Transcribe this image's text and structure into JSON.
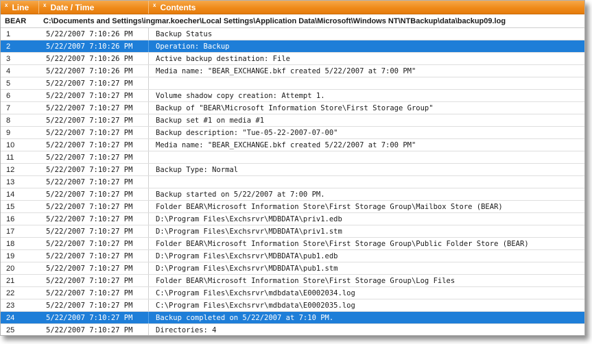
{
  "columns": {
    "line": "Line",
    "date": "Date / Time",
    "contents": "Contents",
    "close_glyph": "x"
  },
  "group": {
    "name": "BEAR",
    "path": "C:\\Documents and Settings\\ingmar.koecher\\Local Settings\\Application Data\\Microsoft\\Windows NT\\NTBackup\\data\\backup09.log"
  },
  "colors": {
    "header_orange": "#ef8a1a",
    "selection_blue": "#1e7ed8"
  },
  "rows": [
    {
      "line": "1",
      "date": "5/22/2007 7:10:26 PM",
      "contents": "Backup Status",
      "selected": false
    },
    {
      "line": "2",
      "date": "5/22/2007 7:10:26 PM",
      "contents": "Operation: Backup",
      "selected": true
    },
    {
      "line": "3",
      "date": "5/22/2007 7:10:26 PM",
      "contents": "Active backup destination: File",
      "selected": false
    },
    {
      "line": "4",
      "date": "5/22/2007 7:10:26 PM",
      "contents": "Media name: \"BEAR_EXCHANGE.bkf created 5/22/2007 at 7:00 PM\"",
      "selected": false
    },
    {
      "line": "5",
      "date": "5/22/2007 7:10:27 PM",
      "contents": "",
      "selected": false
    },
    {
      "line": "6",
      "date": "5/22/2007 7:10:27 PM",
      "contents": "Volume shadow copy creation: Attempt 1.",
      "selected": false
    },
    {
      "line": "7",
      "date": "5/22/2007 7:10:27 PM",
      "contents": "Backup of \"BEAR\\Microsoft Information Store\\First Storage Group\"",
      "selected": false
    },
    {
      "line": "8",
      "date": "5/22/2007 7:10:27 PM",
      "contents": "Backup set #1 on media #1",
      "selected": false
    },
    {
      "line": "9",
      "date": "5/22/2007 7:10:27 PM",
      "contents": "Backup description: \"Tue-05-22-2007-07-00\"",
      "selected": false
    },
    {
      "line": "10",
      "date": "5/22/2007 7:10:27 PM",
      "contents": "Media name: \"BEAR_EXCHANGE.bkf created 5/22/2007 at 7:00 PM\"",
      "selected": false
    },
    {
      "line": "11",
      "date": "5/22/2007 7:10:27 PM",
      "contents": "",
      "selected": false
    },
    {
      "line": "12",
      "date": "5/22/2007 7:10:27 PM",
      "contents": "Backup Type: Normal",
      "selected": false
    },
    {
      "line": "13",
      "date": "5/22/2007 7:10:27 PM",
      "contents": "",
      "selected": false
    },
    {
      "line": "14",
      "date": "5/22/2007 7:10:27 PM",
      "contents": "Backup started on 5/22/2007 at 7:00 PM.",
      "selected": false
    },
    {
      "line": "15",
      "date": "5/22/2007 7:10:27 PM",
      "contents": "Folder BEAR\\Microsoft Information Store\\First Storage Group\\Mailbox Store (BEAR)",
      "selected": false
    },
    {
      "line": "16",
      "date": "5/22/2007 7:10:27 PM",
      "contents": "D:\\Program Files\\Exchsrvr\\MDBDATA\\priv1.edb",
      "selected": false
    },
    {
      "line": "17",
      "date": "5/22/2007 7:10:27 PM",
      "contents": "D:\\Program Files\\Exchsrvr\\MDBDATA\\priv1.stm",
      "selected": false
    },
    {
      "line": "18",
      "date": "5/22/2007 7:10:27 PM",
      "contents": "Folder BEAR\\Microsoft Information Store\\First Storage Group\\Public Folder Store (BEAR)",
      "selected": false
    },
    {
      "line": "19",
      "date": "5/22/2007 7:10:27 PM",
      "contents": "D:\\Program Files\\Exchsrvr\\MDBDATA\\pub1.edb",
      "selected": false
    },
    {
      "line": "20",
      "date": "5/22/2007 7:10:27 PM",
      "contents": "D:\\Program Files\\Exchsrvr\\MDBDATA\\pub1.stm",
      "selected": false
    },
    {
      "line": "21",
      "date": "5/22/2007 7:10:27 PM",
      "contents": "Folder BEAR\\Microsoft Information Store\\First Storage Group\\Log Files",
      "selected": false
    },
    {
      "line": "22",
      "date": "5/22/2007 7:10:27 PM",
      "contents": "C:\\Program Files\\Exchsrvr\\mdbdata\\E0002034.log",
      "selected": false
    },
    {
      "line": "23",
      "date": "5/22/2007 7:10:27 PM",
      "contents": "C:\\Program Files\\Exchsrvr\\mdbdata\\E0002035.log",
      "selected": false
    },
    {
      "line": "24",
      "date": "5/22/2007 7:10:27 PM",
      "contents": "Backup completed on 5/22/2007 at 7:10 PM.",
      "selected": true
    },
    {
      "line": "25",
      "date": "5/22/2007 7:10:27 PM",
      "contents": "Directories: 4",
      "selected": false
    }
  ]
}
